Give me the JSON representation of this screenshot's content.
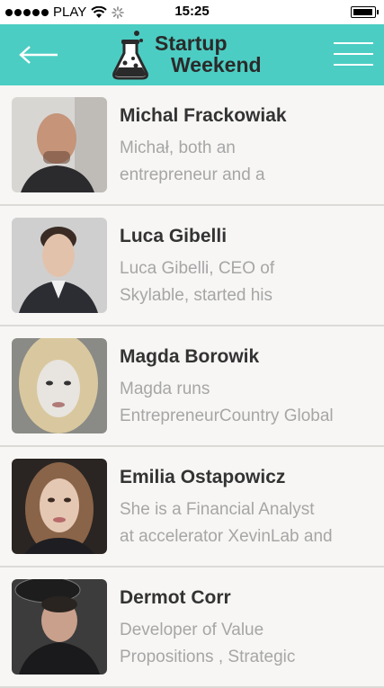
{
  "status_bar": {
    "carrier": "PLAY",
    "time": "15:25"
  },
  "header": {
    "logo_line1": "Startup",
    "logo_line2": "Weekend",
    "back_icon": "arrow-left-icon",
    "menu_icon": "hamburger-menu-icon"
  },
  "colors": {
    "header_bg": "#4ccdc3",
    "name_text": "#333333",
    "desc_text": "#a6a6a6",
    "list_bg": "#f7f6f4"
  },
  "speakers": [
    {
      "name": "Michal Frackowiak",
      "desc1": "Michał, both an",
      "desc2": "entrepreneur and a"
    },
    {
      "name": "Luca Gibelli",
      "desc1": "Luca Gibelli, CEO of",
      "desc2": "Skylable, started his"
    },
    {
      "name": "Magda Borowik",
      "desc1": "Magda runs",
      "desc2": "EntrepreneurCountry Global"
    },
    {
      "name": "Emilia Ostapowicz",
      "desc1": "She is a Financial Analyst",
      "desc2": "at accelerator XevinLab and"
    },
    {
      "name": "Dermot Corr",
      "desc1": "Developer of Value",
      "desc2": "Propositions , Strategic"
    }
  ]
}
